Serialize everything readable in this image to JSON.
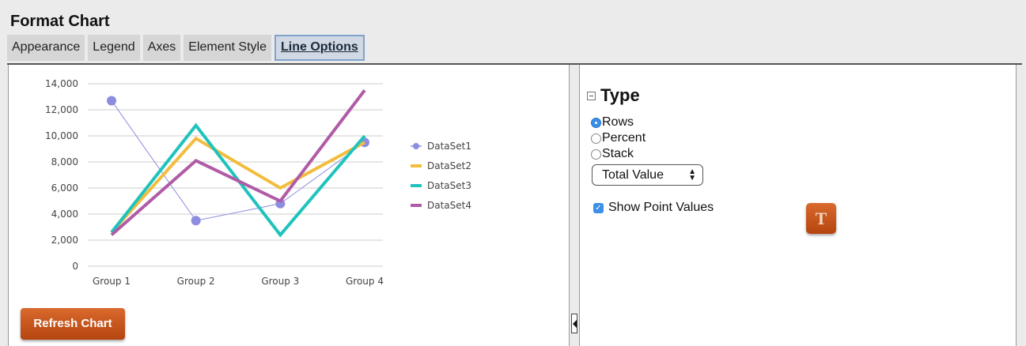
{
  "window": {
    "title": "Format Chart"
  },
  "tabs": [
    {
      "label": "Appearance",
      "active": false
    },
    {
      "label": "Legend",
      "active": false
    },
    {
      "label": "Axes",
      "active": false
    },
    {
      "label": "Element Style",
      "active": false
    },
    {
      "label": "Line Options",
      "active": true
    }
  ],
  "chart_data": {
    "type": "line",
    "categories": [
      "Group 1",
      "Group 2",
      "Group 3",
      "Group 4"
    ],
    "y_ticks": [
      "0",
      "2,000",
      "4,000",
      "6,000",
      "8,000",
      "10,000",
      "12,000",
      "14,000"
    ],
    "ylim": [
      0,
      14000
    ],
    "grid": true,
    "legend_position": "right",
    "series": [
      {
        "name": "DataSet1",
        "values": [
          12700,
          3500,
          4800,
          9500
        ],
        "color": "#8c8ce0",
        "markers": true
      },
      {
        "name": "DataSet2",
        "values": [
          2600,
          9800,
          6000,
          9500
        ],
        "color": "#f2bd3d",
        "markers": false
      },
      {
        "name": "DataSet3",
        "values": [
          2600,
          10800,
          2400,
          10000
        ],
        "color": "#1fc3bd",
        "markers": false
      },
      {
        "name": "DataSet4",
        "values": [
          2400,
          8100,
          5000,
          13500
        ],
        "color": "#b05ba6",
        "markers": false
      }
    ]
  },
  "left_panel": {
    "refresh_label": "Refresh Chart"
  },
  "type_section": {
    "title": "Type",
    "options": [
      {
        "label": "Rows",
        "checked": true
      },
      {
        "label": "Percent",
        "checked": false
      },
      {
        "label": "Stack",
        "checked": false
      }
    ],
    "select_value": "Total Value",
    "show_point_values_label": "Show Point Values",
    "show_point_values_checked": true,
    "text_button_glyph": "T"
  },
  "icons": {
    "collapse": "collapse-icon",
    "splitter": "triangle-left-icon",
    "text": "text-style-icon"
  }
}
